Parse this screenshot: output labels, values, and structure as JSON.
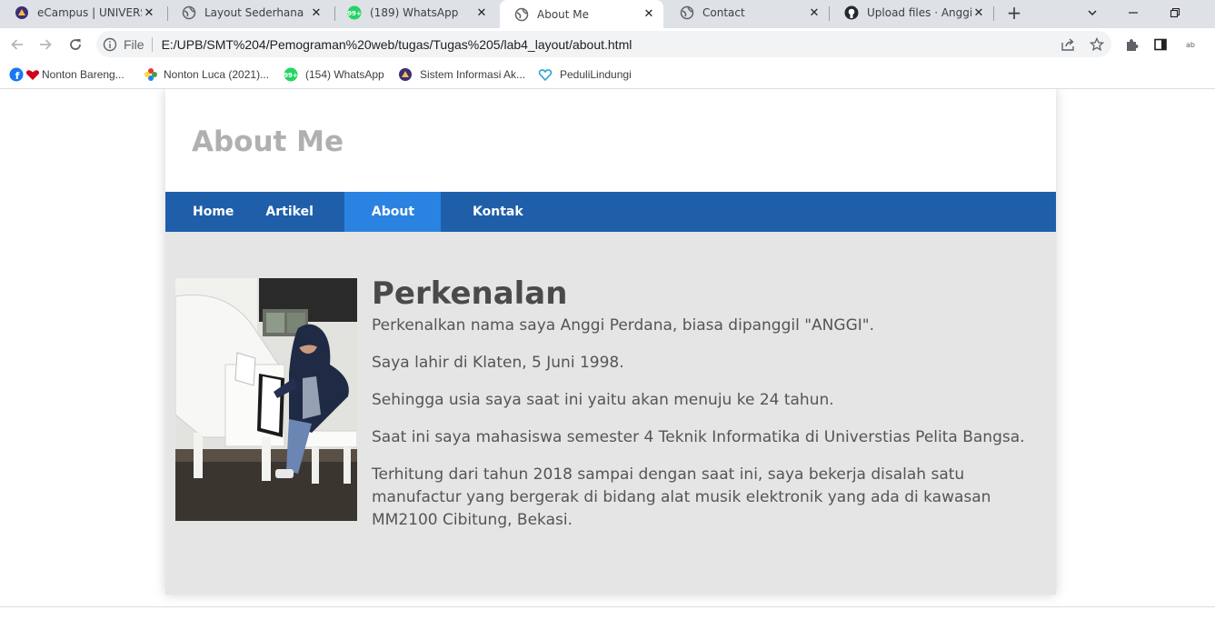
{
  "browser": {
    "tabs": [
      {
        "title": "eCampus | UNIVERSITAS",
        "icon": "university-logo-icon",
        "active": false
      },
      {
        "title": "Layout Sederhana",
        "icon": "globe-icon",
        "active": false
      },
      {
        "title": "(189) WhatsApp",
        "icon": "whatsapp-icon",
        "active": false
      },
      {
        "title": "About Me",
        "icon": "globe-icon",
        "active": true
      },
      {
        "title": "Contact",
        "icon": "globe-icon",
        "active": false
      },
      {
        "title": "Upload files · AnggiPe",
        "icon": "github-icon",
        "active": false
      }
    ],
    "tab_close_glyph": "✕",
    "new_tab_glyph": "+",
    "address": {
      "scheme_label": "File",
      "url": "E:/UPB/SMT%204/Pemograman%20web/tugas/Tugas%205/lab4_layout/about.html"
    },
    "bookmarks": [
      {
        "label": "Nonton Bareng...",
        "icon": "facebook-heart-icon"
      },
      {
        "label": "Nonton Luca (2021)...",
        "icon": "pinwheel-icon"
      },
      {
        "label": "(154) WhatsApp",
        "icon": "whatsapp-icon"
      },
      {
        "label": "Sistem Informasi Ak...",
        "icon": "university-logo-icon"
      },
      {
        "label": "PeduliLindungi",
        "icon": "pedulilindungi-icon"
      }
    ],
    "colors": {
      "tabstrip": "#dee1e6",
      "omnibox": "#f1f3f4"
    }
  },
  "site": {
    "title": "About Me",
    "nav": [
      {
        "label": "Home",
        "active": false
      },
      {
        "label": "Artikel",
        "active": false
      },
      {
        "label": "About",
        "active": true
      },
      {
        "label": "Kontak",
        "active": false
      }
    ],
    "article": {
      "heading": "Perkenalan",
      "paragraphs": [
        "Perkenalkan nama saya Anggi Perdana, biasa dipanggil \"ANGGI\".",
        "Saya lahir di Klaten, 5 Juni 1998.",
        "Sehingga usia saya saat ini yaitu akan menuju ke 24 tahun.",
        "Saat ini saya mahasiswa semester 4 Teknik Informatika di Universtias Pelita Bangsa.",
        "Terhitung dari tahun 2018 sampai dengan saat ini, saya bekerja disalah satu manufactur yang bergerak di bidang alat musik elektronik yang ada di kawasan MM2100 Cibitung, Bekasi."
      ]
    },
    "colors": {
      "nav": "#1f5faa",
      "nav_active": "#2b83e1",
      "content_bg": "#e5e5e5",
      "title": "#b0b0b0"
    }
  }
}
